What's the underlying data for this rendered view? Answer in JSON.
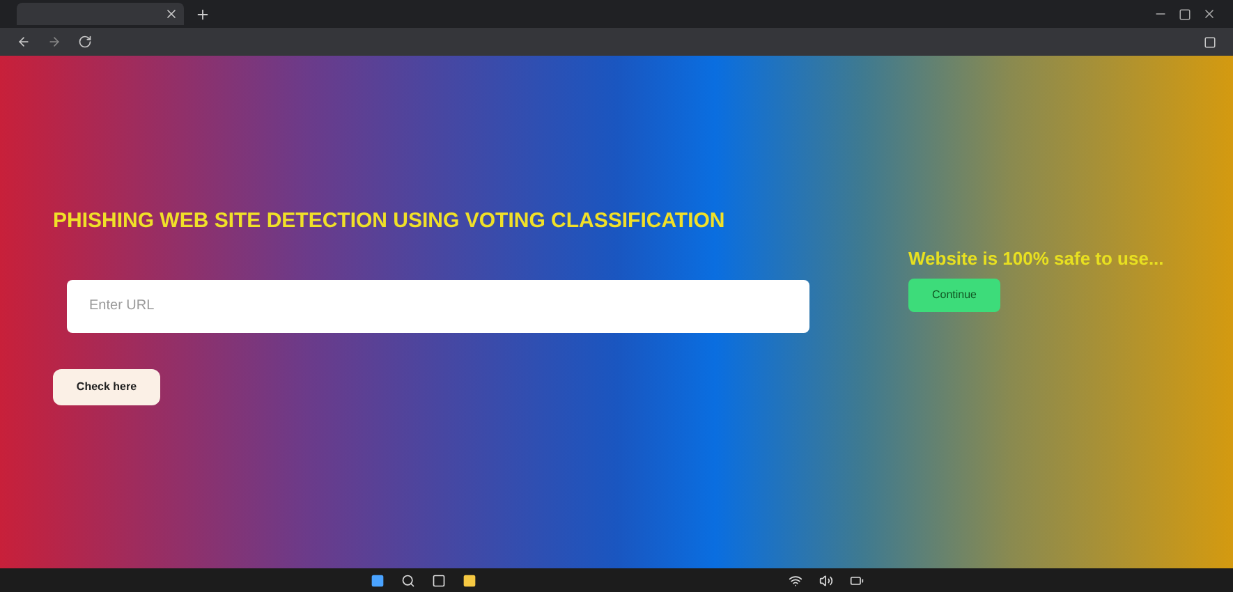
{
  "page": {
    "title": "PHISHING WEB SITE DETECTION USING VOTING CLASSIFICATION"
  },
  "url_field": {
    "placeholder": "Enter URL"
  },
  "check_button": {
    "label": "Check here"
  },
  "result": {
    "message": "Website is 100% safe to use...",
    "button": "Continue"
  }
}
